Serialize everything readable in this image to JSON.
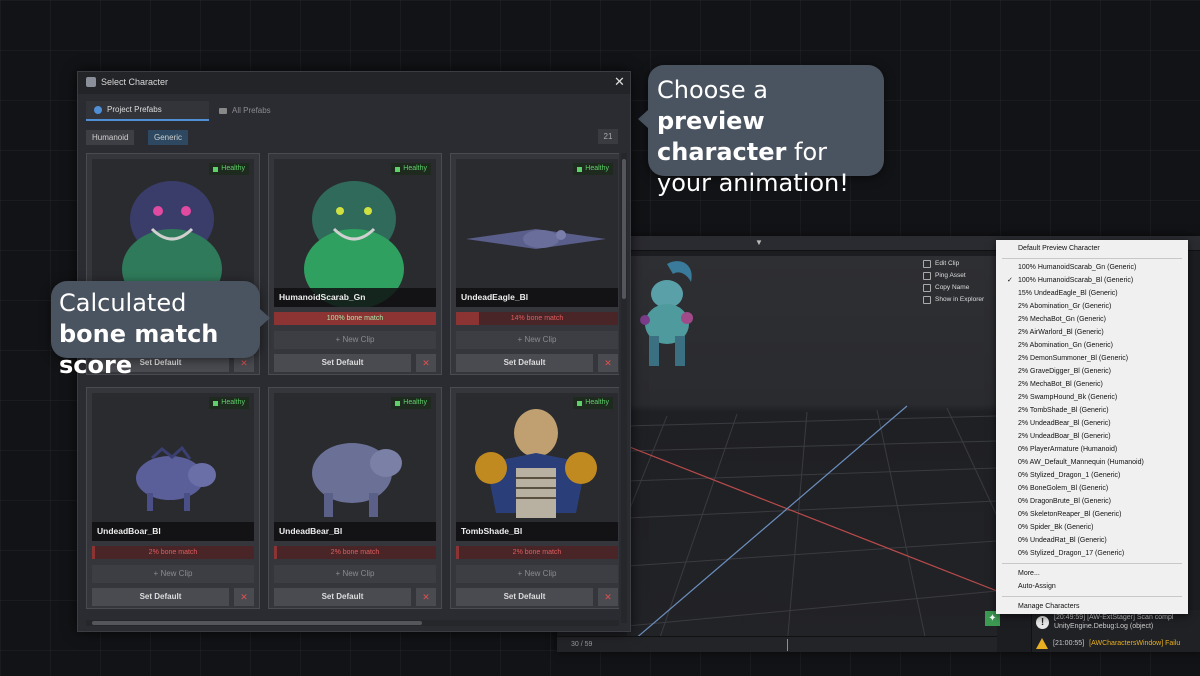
{
  "window": {
    "title": "Select Character",
    "close_symbol": "✕"
  },
  "tabs": [
    {
      "label": "Project Prefabs",
      "active": true,
      "icon": "prefab-icon"
    },
    {
      "label": "All Prefabs",
      "active": false,
      "icon": "folder-icon"
    }
  ],
  "filters": [
    {
      "label": "Humanoid",
      "selected": false
    },
    {
      "label": "Generic",
      "selected": true
    }
  ],
  "count": "21",
  "cards": [
    {
      "name": "",
      "health": "Healthy",
      "match_label": "",
      "match_pct": null,
      "new_clip": "+ New Clip",
      "set_default": "Set Default",
      "delete": "✕",
      "model": "scarab-bl"
    },
    {
      "name": "HumanoidScarab_Gn",
      "health": "Healthy",
      "match_label": "100% bone match",
      "match_pct": 100,
      "new_clip": "+ New Clip",
      "set_default": "Set Default",
      "delete": "✕",
      "model": "scarab-gn"
    },
    {
      "name": "UndeadEagle_Bl",
      "health": "Healthy",
      "match_label": "14% bone match",
      "match_pct": 14,
      "new_clip": "+ New Clip",
      "set_default": "Set Default",
      "delete": "✕",
      "model": "eagle"
    },
    {
      "name": "UndeadBoar_Bl",
      "health": "Healthy",
      "match_label": "2% bone match",
      "match_pct": 2,
      "new_clip": "+ New Clip",
      "set_default": "Set Default",
      "delete": "✕",
      "model": "boar"
    },
    {
      "name": "UndeadBear_Bl",
      "health": "Healthy",
      "match_label": "2% bone match",
      "match_pct": 2,
      "new_clip": "+ New Clip",
      "set_default": "Set Default",
      "delete": "✕",
      "model": "bear"
    },
    {
      "name": "TombShade_Bl",
      "health": "Healthy",
      "match_label": "2% bone match",
      "match_pct": 2,
      "new_clip": "+ New Clip",
      "set_default": "Set Default",
      "delete": "✕",
      "model": "tombshade"
    }
  ],
  "callouts": {
    "preview": {
      "pre": "Choose a ",
      "bold": "preview character",
      "post": " for your animation!"
    },
    "bone": {
      "pre": "Calculated ",
      "bold": "bone match score",
      "post": ""
    }
  },
  "scene": {
    "context_actions": [
      "Edit Clip",
      "Ping Asset",
      "Copy Name",
      "Show in Explorer"
    ],
    "timeline_label": "30 / 59",
    "console": [
      {
        "level": "info",
        "text": "[20:49:59] [AW-ExtStager] Scan compl",
        "text2": "UnityEngine.Debug:Log (object)"
      },
      {
        "level": "warning",
        "time": "[21:00:55]",
        "text": "[AWCharactersWindow] Failu"
      }
    ]
  },
  "dropdown": {
    "header": "Default Preview Character",
    "items": [
      {
        "label": "100%  HumanoidScarab_Gn   (Generic)",
        "checked": false
      },
      {
        "label": "100%  HumanoidScarab_Bl   (Generic)",
        "checked": true
      },
      {
        "label": "15%  UndeadEagle_Bl   (Generic)",
        "checked": false
      },
      {
        "label": "2%  Abomination_Gr   (Generic)",
        "checked": false
      },
      {
        "label": "2%  MechaBot_Gn   (Generic)",
        "checked": false
      },
      {
        "label": "2%  AirWarlord_Bl   (Generic)",
        "checked": false
      },
      {
        "label": "2%  Abomination_Gn   (Generic)",
        "checked": false
      },
      {
        "label": "2%  DemonSummoner_Bl   (Generic)",
        "checked": false
      },
      {
        "label": "2%  GraveDigger_Bl   (Generic)",
        "checked": false
      },
      {
        "label": "2%  MechaBot_Bl   (Generic)",
        "checked": false
      },
      {
        "label": "2%  SwampHound_Bk   (Generic)",
        "checked": false
      },
      {
        "label": "2%  TombShade_Bl   (Generic)",
        "checked": false
      },
      {
        "label": "2%  UndeadBear_Bl   (Generic)",
        "checked": false
      },
      {
        "label": "2%  UndeadBoar_Bl   (Generic)",
        "checked": false
      },
      {
        "label": "0%  PlayerArmature   (Humanoid)",
        "checked": false
      },
      {
        "label": "0%  AW_Default_Mannequin   (Humanoid)",
        "checked": false
      },
      {
        "label": "0%  Stylized_Dragon_1   (Generic)",
        "checked": false
      },
      {
        "label": "0%  BoneGolem_Bl   (Generic)",
        "checked": false
      },
      {
        "label": "0%  DragonBrute_Bl   (Generic)",
        "checked": false
      },
      {
        "label": "0%  SkeletonReaper_Bl   (Generic)",
        "checked": false
      },
      {
        "label": "0%  Spider_Bk   (Generic)",
        "checked": false
      },
      {
        "label": "0%  UndeadRat_Bl   (Generic)",
        "checked": false
      },
      {
        "label": "0%  Stylized_Dragon_17   (Generic)",
        "checked": false
      }
    ],
    "more": "More...",
    "auto_assign": "Auto-Assign",
    "manage": "Manage Characters"
  }
}
